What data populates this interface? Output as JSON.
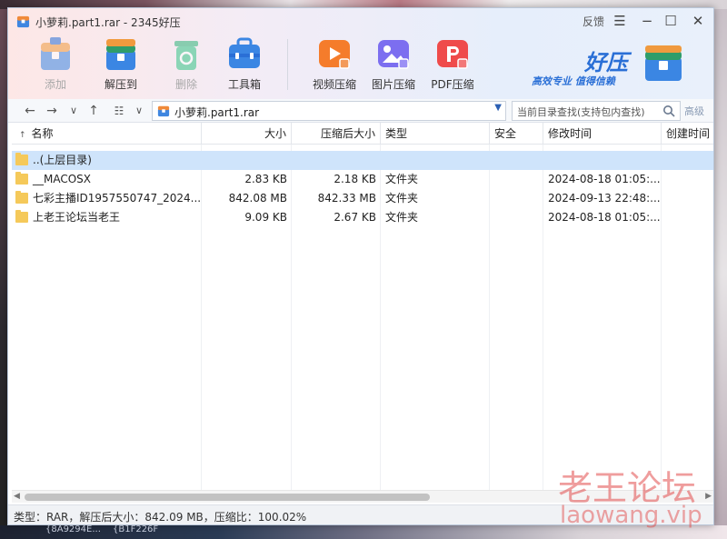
{
  "window": {
    "title": "小萝莉.part1.rar - 2345好压",
    "feedback_label": "反馈",
    "menu_icon": "menu-icon",
    "minimize_icon": "minimize-icon",
    "maximize_icon": "maximize-icon",
    "close_icon": "close-icon"
  },
  "toolbar": {
    "tools": [
      {
        "label": "添加",
        "icon": "add-icon",
        "enabled": false
      },
      {
        "label": "解压到",
        "icon": "extract-icon",
        "enabled": true
      },
      {
        "label": "删除",
        "icon": "delete-icon",
        "enabled": false
      },
      {
        "label": "工具箱",
        "icon": "toolbox-icon",
        "enabled": true
      },
      {
        "label": "视频压缩",
        "icon": "video-compress-icon",
        "enabled": true
      },
      {
        "label": "图片压缩",
        "icon": "image-compress-icon",
        "enabled": true
      },
      {
        "label": "PDF压缩",
        "icon": "pdf-compress-icon",
        "enabled": true
      }
    ]
  },
  "brand": {
    "logo_text": "好压",
    "slogan": "高效专业 值得信赖"
  },
  "address": {
    "path": "小萝莉.part1.rar",
    "search_placeholder": "当前目录查找(支持包内查找)",
    "advanced_label": "高级"
  },
  "columns": [
    "名称",
    "大小",
    "压缩后大小",
    "类型",
    "安全",
    "修改时间",
    "创建时间"
  ],
  "rows": [
    {
      "name": "..(上层目录)",
      "size": "",
      "packed": "",
      "type": "",
      "security": "",
      "modified": "",
      "created": "",
      "selected": true
    },
    {
      "name": "__MACOSX",
      "size": "2.83 KB",
      "packed": "2.18 KB",
      "type": "文件夹",
      "security": "",
      "modified": "2024-08-18 01:05:...",
      "created": "",
      "selected": false
    },
    {
      "name": "七彩主播ID1957550747_2024...",
      "size": "842.08 MB",
      "packed": "842.33 MB",
      "type": "文件夹",
      "security": "",
      "modified": "2024-09-13 22:48:...",
      "created": "",
      "selected": false
    },
    {
      "name": "上老王论坛当老王",
      "size": "9.09 KB",
      "packed": "2.67 KB",
      "type": "文件夹",
      "security": "",
      "modified": "2024-08-18 01:05:...",
      "created": "",
      "selected": false
    }
  ],
  "status": {
    "text": "类型：RAR，解压后大小：842.09 MB，压缩比：100.02%"
  },
  "watermark": {
    "line1": "老王论坛",
    "line2": "laowang.vip"
  },
  "background": {
    "taskbar_text_1": "{8A9294E...",
    "taskbar_text_2": "{B1F226F"
  },
  "colors": {
    "accent": "#2a6fd6",
    "selection": "#cfe4fb",
    "folder": "#f5c95a",
    "watermark": "#e24c4c"
  }
}
